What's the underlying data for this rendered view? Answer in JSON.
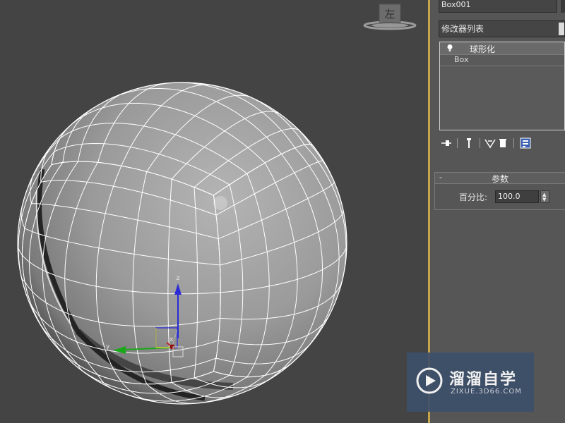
{
  "viewcube": {
    "label": "左"
  },
  "gizmo": {
    "x_label": "x",
    "y_label": "y",
    "z_label": "z"
  },
  "panel": {
    "object_name": "Box001",
    "modifier_list_label": "修改器列表",
    "stack": {
      "items": [
        "球形化",
        "Box"
      ]
    },
    "rollout": {
      "toggle": "-",
      "title": "参数",
      "percent_label": "百分比:",
      "percent_value": "100.0"
    }
  },
  "watermark": {
    "title": "溜溜自学",
    "subtitle": "ZIXUE.3D66.COM"
  },
  "colors": {
    "background": "#444444",
    "panel": "#565656",
    "viewport_border": "#c7a54a",
    "wireframe": "#ffffff"
  }
}
